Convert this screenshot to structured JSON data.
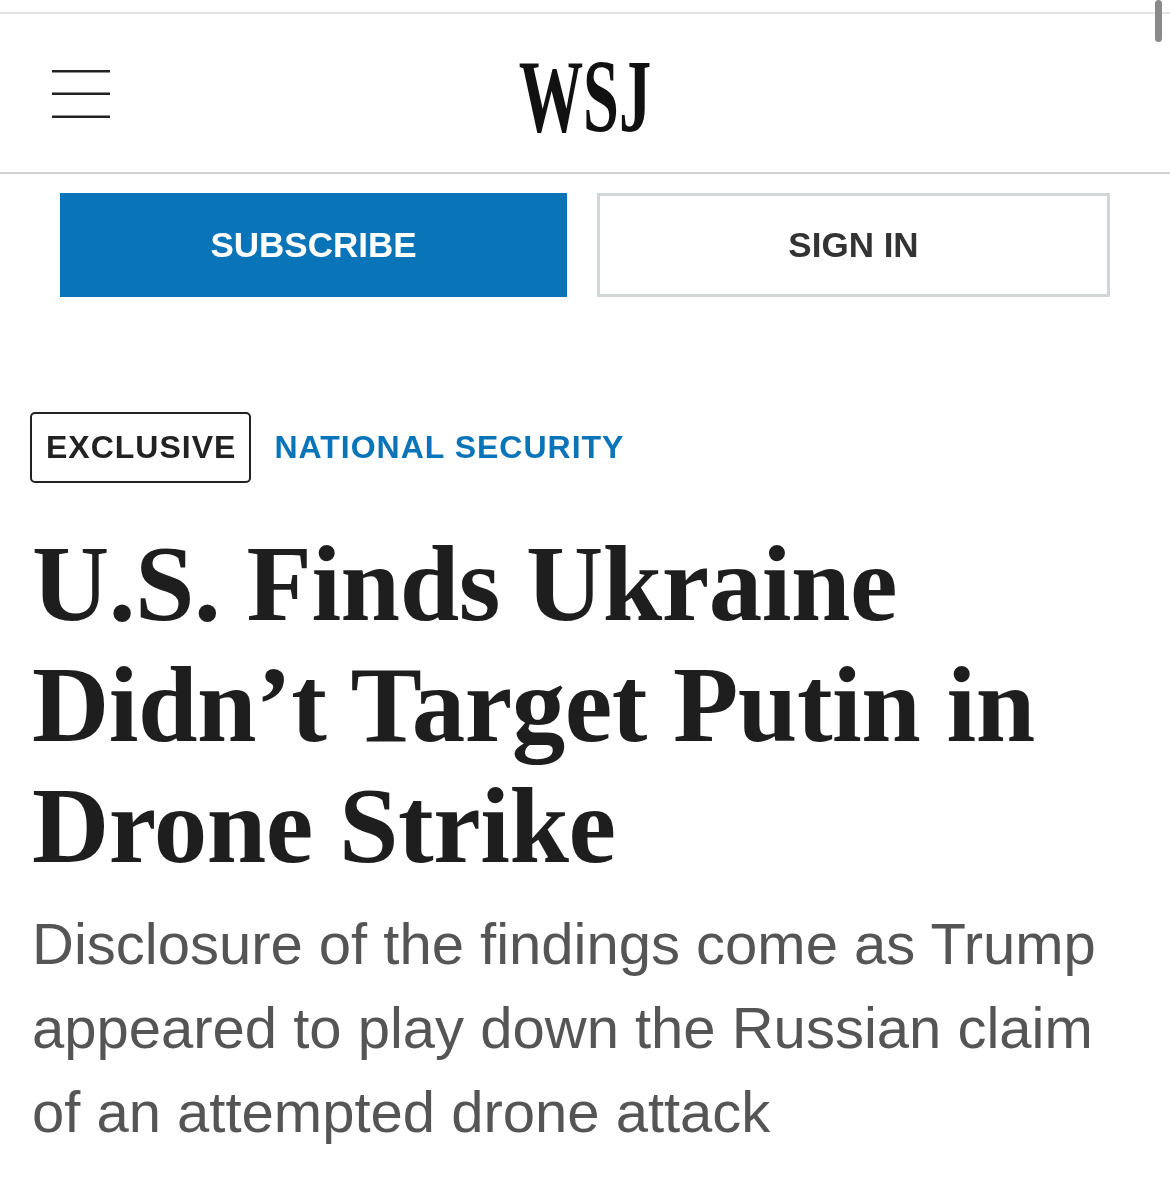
{
  "header": {
    "logo": "WSJ"
  },
  "actions": [
    {
      "label": "SUBSCRIBE",
      "kind": "primary"
    },
    {
      "label": "SIGN IN",
      "kind": "secondary"
    }
  ],
  "article": {
    "labels": [
      {
        "text": "EXCLUSIVE",
        "kind": "badge"
      },
      {
        "text": "NATIONAL SECURITY",
        "kind": "section"
      }
    ],
    "headline": "U.S. Finds Ukraine Didn’t Target Putin in Drone Strike",
    "dek": "Disclosure of the findings come as Trump appeared to play down the Russian claim of an attempted drone attack"
  }
}
